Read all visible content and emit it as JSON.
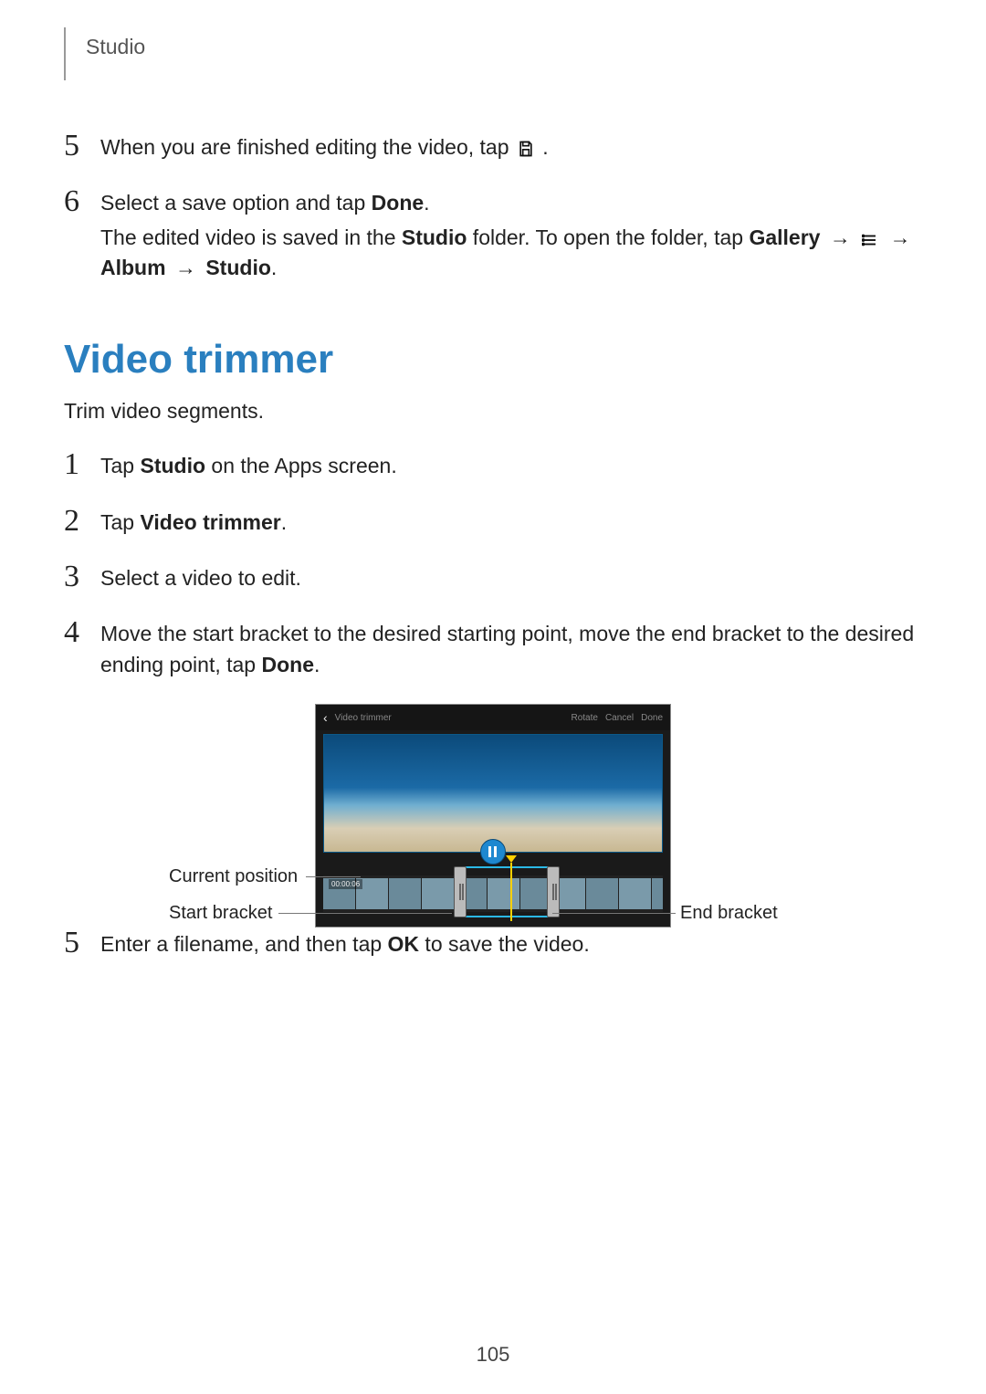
{
  "header": "Studio",
  "topList": {
    "item5": {
      "num": "5",
      "text_a": "When you are finished editing the video, tap ",
      "text_b": "."
    },
    "item6": {
      "num": "6",
      "line1_a": "Select a save option and tap ",
      "line1_bold": "Done",
      "line1_b": ".",
      "line2_a": "The edited video is saved in the ",
      "line2_bold1": "Studio",
      "line2_b": " folder. To open the folder, tap ",
      "line2_bold2": "Gallery",
      "line2_arrow1": " → ",
      "line2_arrow2": " → ",
      "line3_bold1": "Album",
      "line3_arrow": " → ",
      "line3_bold2": "Studio",
      "line3_end": "."
    }
  },
  "section": {
    "title": "Video trimmer",
    "intro": "Trim video segments."
  },
  "steps": {
    "s1": {
      "num": "1",
      "a": "Tap ",
      "bold": "Studio",
      "b": " on the Apps screen."
    },
    "s2": {
      "num": "2",
      "a": "Tap ",
      "bold": "Video trimmer",
      "b": "."
    },
    "s3": {
      "num": "3",
      "text": "Select a video to edit."
    },
    "s4": {
      "num": "4",
      "a": "Move the start bracket to the desired starting point, move the end bracket to the desired ending point, tap ",
      "bold": "Done",
      "b": "."
    },
    "s5": {
      "num": "5",
      "a": "Enter a filename, and then tap ",
      "bold": "OK",
      "b": " to save the video."
    }
  },
  "diagram": {
    "label_current": "Current position",
    "label_start": "Start bracket",
    "label_end": "End bracket",
    "ss_title": "Video trimmer",
    "ss_rotate": "Rotate",
    "ss_cancel": "Cancel",
    "ss_done": "Done",
    "ss_time": "00:00:06"
  },
  "pageNumber": "105"
}
